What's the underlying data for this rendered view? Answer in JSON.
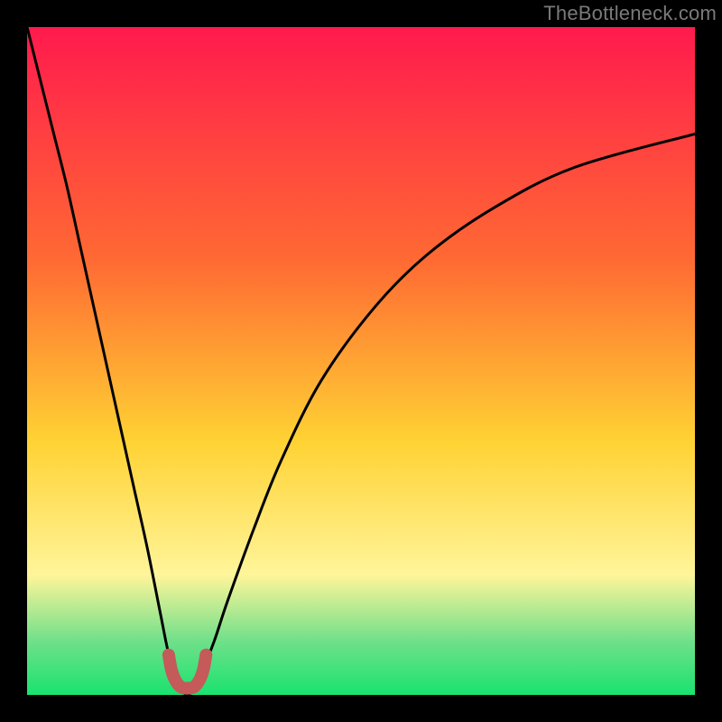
{
  "watermark": "TheBottleneck.com",
  "colors": {
    "frame_bg": "#000000",
    "watermark": "#7a7a7a",
    "gradient_top": "#ff1a4d",
    "gradient_mid_upper": "#ff6a33",
    "gradient_mid": "#ffd233",
    "gradient_mid_lower": "#fff59a",
    "gradient_lower_green": "#6fe08a",
    "gradient_bottom": "#19e36f",
    "curve": "#000000",
    "marker": "#c55a5a"
  },
  "chart_data": {
    "type": "line",
    "title": "",
    "xlabel": "",
    "ylabel": "",
    "xlim": [
      0,
      100
    ],
    "ylim": [
      0,
      100
    ],
    "grid": false,
    "legend": false,
    "series": [
      {
        "name": "bottleneck-curve",
        "x": [
          0,
          2,
          4,
          6,
          8,
          10,
          12,
          14,
          16,
          18,
          20,
          21,
          22,
          23,
          24,
          25,
          26,
          28,
          30,
          34,
          38,
          44,
          52,
          60,
          70,
          82,
          100
        ],
        "y": [
          100,
          92,
          84,
          76,
          67,
          58,
          49,
          40,
          31,
          22,
          12,
          7,
          3,
          1,
          0,
          1,
          3,
          8,
          14,
          25,
          35,
          47,
          58,
          66,
          73,
          79,
          84
        ]
      },
      {
        "name": "optimal-marker",
        "x": [
          21.2,
          21.6,
          22.2,
          23.0,
          24.0,
          25.0,
          25.8,
          26.4,
          26.8
        ],
        "y": [
          6.0,
          3.8,
          2.2,
          1.2,
          1.0,
          1.2,
          2.2,
          3.8,
          6.0
        ]
      }
    ],
    "annotations": []
  }
}
